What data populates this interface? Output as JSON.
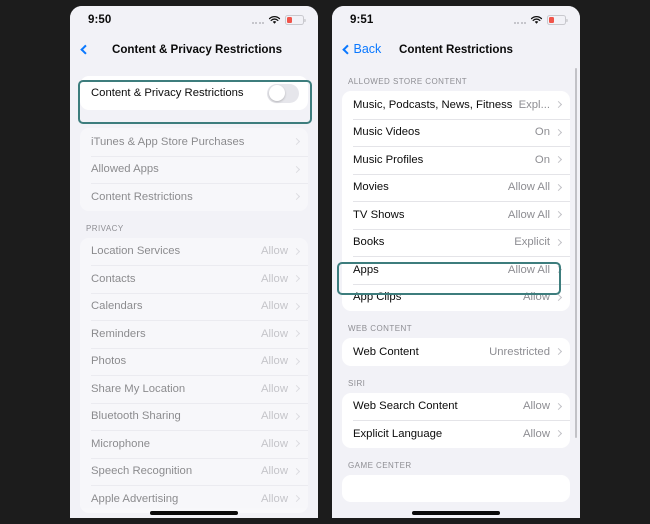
{
  "phones": [
    {
      "id": "left",
      "status": {
        "time": "9:50",
        "wifi_icon": "wifi-icon",
        "battery_icon": "battery-low-icon",
        "signal_icon": "signal-dots-icon"
      },
      "nav": {
        "back_label": "",
        "title": "Content & Privacy Restrictions",
        "back_icon": "chevron-left-icon"
      },
      "toggle_row": {
        "label": "Content & Privacy Restrictions",
        "state": "off"
      },
      "groups": [
        {
          "header": "",
          "dimmed": true,
          "rows": [
            {
              "label": "iTunes & App Store Purchases",
              "value": ""
            },
            {
              "label": "Allowed Apps",
              "value": ""
            },
            {
              "label": "Content Restrictions",
              "value": ""
            }
          ]
        },
        {
          "header": "PRIVACY",
          "dimmed": true,
          "rows": [
            {
              "label": "Location Services",
              "value": "Allow"
            },
            {
              "label": "Contacts",
              "value": "Allow"
            },
            {
              "label": "Calendars",
              "value": "Allow"
            },
            {
              "label": "Reminders",
              "value": "Allow"
            },
            {
              "label": "Photos",
              "value": "Allow"
            },
            {
              "label": "Share My Location",
              "value": "Allow"
            },
            {
              "label": "Bluetooth Sharing",
              "value": "Allow"
            },
            {
              "label": "Microphone",
              "value": "Allow"
            },
            {
              "label": "Speech Recognition",
              "value": "Allow"
            },
            {
              "label": "Apple Advertising",
              "value": "Allow"
            }
          ]
        }
      ]
    },
    {
      "id": "right",
      "status": {
        "time": "9:51",
        "wifi_icon": "wifi-icon",
        "battery_icon": "battery-low-icon",
        "signal_icon": "signal-dots-icon"
      },
      "nav": {
        "back_label": "Back",
        "title": "Content Restrictions",
        "back_icon": "chevron-left-icon"
      },
      "groups": [
        {
          "header": "ALLOWED STORE CONTENT",
          "dimmed": false,
          "rows": [
            {
              "label": "Music, Podcasts, News, Fitness",
              "value": "Expl..."
            },
            {
              "label": "Music Videos",
              "value": "On"
            },
            {
              "label": "Music Profiles",
              "value": "On"
            },
            {
              "label": "Movies",
              "value": "Allow All"
            },
            {
              "label": "TV Shows",
              "value": "Allow All"
            },
            {
              "label": "Books",
              "value": "Explicit"
            },
            {
              "label": "Apps",
              "value": "Allow All"
            },
            {
              "label": "App Clips",
              "value": "Allow"
            }
          ]
        },
        {
          "header": "WEB CONTENT",
          "dimmed": false,
          "rows": [
            {
              "label": "Web Content",
              "value": "Unrestricted"
            }
          ]
        },
        {
          "header": "SIRI",
          "dimmed": false,
          "rows": [
            {
              "label": "Web Search Content",
              "value": "Allow"
            },
            {
              "label": "Explicit Language",
              "value": "Allow"
            }
          ]
        },
        {
          "header": "GAME CENTER",
          "dimmed": false,
          "rows": []
        }
      ]
    }
  ],
  "highlights": {
    "color": "#3d7d7d",
    "items": [
      {
        "name": "content-privacy-restrictions-toggle-highlight",
        "target": "Content & Privacy Restrictions"
      },
      {
        "name": "apps-row-highlight",
        "target": "Apps"
      }
    ]
  }
}
